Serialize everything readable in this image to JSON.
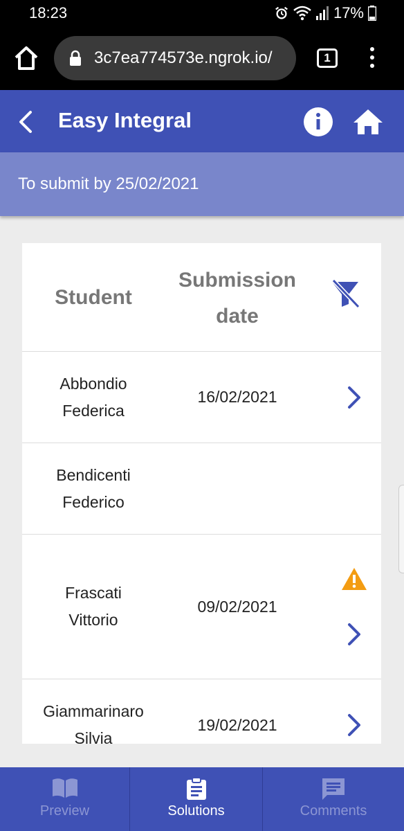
{
  "status_bar": {
    "time": "18:23",
    "battery": "17%"
  },
  "browser": {
    "url": "3c7ea774573e.ngrok.io/",
    "tab_count": "1"
  },
  "app_bar": {
    "title": "Easy Integral"
  },
  "subheader": {
    "text": "To submit by 25/02/2021"
  },
  "table": {
    "headers": {
      "student": "Student",
      "submission_line1": "Submission",
      "submission_line2": "date"
    },
    "rows": [
      {
        "name_line1": "Abbondio",
        "name_line2": "Federica",
        "date": "16/02/2021",
        "warning": false,
        "has_detail": true
      },
      {
        "name_line1": "Bendicenti",
        "name_line2": "Federico",
        "date": "",
        "warning": false,
        "has_detail": false
      },
      {
        "name_line1": "Frascati",
        "name_line2": "Vittorio",
        "date": "09/02/2021",
        "warning": true,
        "has_detail": true
      },
      {
        "name_line1": "Giammarinaro",
        "name_line2": "Silvia",
        "date": "19/02/2021",
        "warning": false,
        "has_detail": true
      }
    ]
  },
  "bottom_nav": {
    "tabs": [
      {
        "label": "Preview",
        "icon": "book-icon",
        "active": false
      },
      {
        "label": "Solutions",
        "icon": "clipboard-icon",
        "active": true
      },
      {
        "label": "Comments",
        "icon": "comment-icon",
        "active": false
      }
    ]
  },
  "colors": {
    "primary": "#3f51b5",
    "primary_light": "#7986cb",
    "warning": "#f39c12",
    "background": "#ececec"
  },
  "icons": [
    "alarm-icon",
    "wifi-icon",
    "signal-icon",
    "battery-icon",
    "home-icon",
    "lock-icon",
    "tabs-icon",
    "kebab-menu-icon",
    "back-arrow-icon",
    "info-icon",
    "filter-off-icon",
    "chevron-right-icon",
    "warning-icon"
  ]
}
